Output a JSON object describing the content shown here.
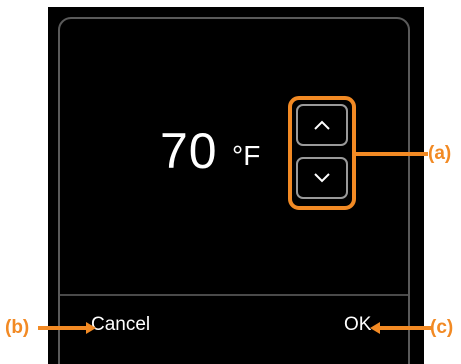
{
  "dialog": {
    "temperature_value": "70",
    "temperature_unit": "°F",
    "cancel_label": "Cancel",
    "ok_label": "OK"
  },
  "icons": {
    "increase": "chevron-up-icon",
    "decrease": "chevron-down-icon"
  },
  "callouts": {
    "a": "(a)",
    "b": "(b)",
    "c": "(c)"
  },
  "colors": {
    "callout_accent": "#f28a24",
    "screen_background": "#000000",
    "text": "#ffffff"
  }
}
